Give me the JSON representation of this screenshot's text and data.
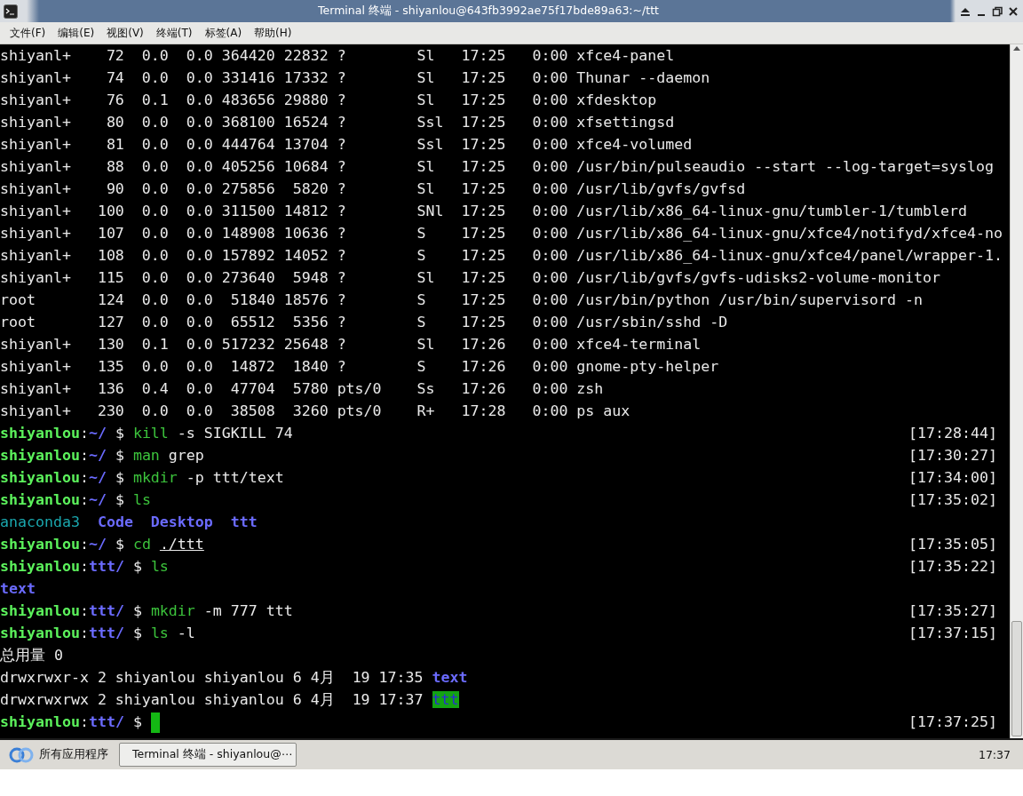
{
  "window": {
    "title": "Terminal 终端 - shiyanlou@643fb3992ae75f17bde89a63:~/ttt"
  },
  "menu": [
    {
      "label": "文件(F)"
    },
    {
      "label": "编辑(E)"
    },
    {
      "label": "视图(V)"
    },
    {
      "label": "终端(T)"
    },
    {
      "label": "标签(A)"
    },
    {
      "label": "帮助(H)"
    }
  ],
  "terminal": {
    "lines": [
      {
        "segments": [
          {
            "kind": "plain",
            "text": "shiyanl+    72  0.0  0.0 364420 22832 ?        Sl   17:25   0:00 xfce4-panel"
          }
        ]
      },
      {
        "segments": [
          {
            "kind": "plain",
            "text": "shiyanl+    74  0.0  0.0 331416 17332 ?        Sl   17:25   0:00 Thunar --daemon"
          }
        ]
      },
      {
        "segments": [
          {
            "kind": "plain",
            "text": "shiyanl+    76  0.1  0.0 483656 29880 ?        Sl   17:25   0:00 xfdesktop"
          }
        ]
      },
      {
        "segments": [
          {
            "kind": "plain",
            "text": "shiyanl+    80  0.0  0.0 368100 16524 ?        Ssl  17:25   0:00 xfsettingsd"
          }
        ]
      },
      {
        "segments": [
          {
            "kind": "plain",
            "text": "shiyanl+    81  0.0  0.0 444764 13704 ?        Ssl  17:25   0:00 xfce4-volumed"
          }
        ]
      },
      {
        "segments": [
          {
            "kind": "plain",
            "text": "shiyanl+    88  0.0  0.0 405256 10684 ?        Sl   17:25   0:00 /usr/bin/pulseaudio --start --log-target=syslog"
          }
        ]
      },
      {
        "segments": [
          {
            "kind": "plain",
            "text": "shiyanl+    90  0.0  0.0 275856  5820 ?        Sl   17:25   0:00 /usr/lib/gvfs/gvfsd"
          }
        ]
      },
      {
        "segments": [
          {
            "kind": "plain",
            "text": "shiyanl+   100  0.0  0.0 311500 14812 ?        SNl  17:25   0:00 /usr/lib/x86_64-linux-gnu/tumbler-1/tumblerd"
          }
        ]
      },
      {
        "segments": [
          {
            "kind": "plain",
            "text": "shiyanl+   107  0.0  0.0 148908 10636 ?        S    17:25   0:00 /usr/lib/x86_64-linux-gnu/xfce4/notifyd/xfce4-no"
          }
        ]
      },
      {
        "segments": [
          {
            "kind": "plain",
            "text": "shiyanl+   108  0.0  0.0 157892 14052 ?        S    17:25   0:00 /usr/lib/x86_64-linux-gnu/xfce4/panel/wrapper-1."
          }
        ]
      },
      {
        "segments": [
          {
            "kind": "plain",
            "text": "shiyanl+   115  0.0  0.0 273640  5948 ?        Sl   17:25   0:00 /usr/lib/gvfs/gvfs-udisks2-volume-monitor"
          }
        ]
      },
      {
        "segments": [
          {
            "kind": "plain",
            "text": "root       124  0.0  0.0  51840 18576 ?        S    17:25   0:00 /usr/bin/python /usr/bin/supervisord -n"
          }
        ]
      },
      {
        "segments": [
          {
            "kind": "plain",
            "text": "root       127  0.0  0.0  65512  5356 ?        S    17:25   0:00 /usr/sbin/sshd -D"
          }
        ]
      },
      {
        "segments": [
          {
            "kind": "plain",
            "text": "shiyanl+   130  0.1  0.0 517232 25648 ?        Sl   17:26   0:00 xfce4-terminal"
          }
        ]
      },
      {
        "segments": [
          {
            "kind": "plain",
            "text": "shiyanl+   135  0.0  0.0  14872  1840 ?        S    17:26   0:00 gnome-pty-helper"
          }
        ]
      },
      {
        "segments": [
          {
            "kind": "plain",
            "text": "shiyanl+   136  0.4  0.0  47704  5780 pts/0    Ss   17:26   0:00 zsh"
          }
        ]
      },
      {
        "segments": [
          {
            "kind": "plain",
            "text": "shiyanl+   230  0.0  0.0  38508  3260 pts/0    R+   17:28   0:00 ps aux"
          }
        ]
      },
      {
        "segments": [
          {
            "kind": "user",
            "text": "shiyanlou"
          },
          {
            "kind": "plain",
            "text": ":"
          },
          {
            "kind": "path",
            "text": "~/"
          },
          {
            "kind": "plain",
            "text": " $ "
          },
          {
            "kind": "cmd",
            "text": "kill"
          },
          {
            "kind": "plain",
            "text": " -s SIGKILL 74"
          }
        ],
        "time": "[17:28:44]"
      },
      {
        "segments": [
          {
            "kind": "user",
            "text": "shiyanlou"
          },
          {
            "kind": "plain",
            "text": ":"
          },
          {
            "kind": "path",
            "text": "~/"
          },
          {
            "kind": "plain",
            "text": " $ "
          },
          {
            "kind": "cmd",
            "text": "man"
          },
          {
            "kind": "plain",
            "text": " grep"
          }
        ],
        "time": "[17:30:27]"
      },
      {
        "segments": [
          {
            "kind": "user",
            "text": "shiyanlou"
          },
          {
            "kind": "plain",
            "text": ":"
          },
          {
            "kind": "path",
            "text": "~/"
          },
          {
            "kind": "plain",
            "text": " $ "
          },
          {
            "kind": "cmd",
            "text": "mkdir"
          },
          {
            "kind": "plain",
            "text": " -p ttt/text"
          }
        ],
        "time": "[17:34:00]"
      },
      {
        "segments": [
          {
            "kind": "user",
            "text": "shiyanlou"
          },
          {
            "kind": "plain",
            "text": ":"
          },
          {
            "kind": "path",
            "text": "~/"
          },
          {
            "kind": "plain",
            "text": " $ "
          },
          {
            "kind": "cmd",
            "text": "ls"
          }
        ],
        "time": "[17:35:02]"
      },
      {
        "segments": [
          {
            "kind": "link",
            "text": "anaconda3  "
          },
          {
            "kind": "dir",
            "text": "Code  "
          },
          {
            "kind": "dir",
            "text": "Desktop  "
          },
          {
            "kind": "dir",
            "text": "ttt"
          }
        ]
      },
      {
        "segments": [
          {
            "kind": "user",
            "text": "shiyanlou"
          },
          {
            "kind": "plain",
            "text": ":"
          },
          {
            "kind": "path",
            "text": "~/"
          },
          {
            "kind": "plain",
            "text": " $ "
          },
          {
            "kind": "cmd",
            "text": "cd "
          },
          {
            "kind": "underline",
            "text": "./ttt"
          }
        ],
        "time": "[17:35:05]"
      },
      {
        "segments": [
          {
            "kind": "user",
            "text": "shiyanlou"
          },
          {
            "kind": "plain",
            "text": ":"
          },
          {
            "kind": "path",
            "text": "ttt/"
          },
          {
            "kind": "plain",
            "text": " $ "
          },
          {
            "kind": "cmd",
            "text": "ls"
          }
        ],
        "time": "[17:35:22]"
      },
      {
        "segments": [
          {
            "kind": "dir",
            "text": "text"
          }
        ]
      },
      {
        "segments": [
          {
            "kind": "user",
            "text": "shiyanlou"
          },
          {
            "kind": "plain",
            "text": ":"
          },
          {
            "kind": "path",
            "text": "ttt/"
          },
          {
            "kind": "plain",
            "text": " $ "
          },
          {
            "kind": "cmd",
            "text": "mkdir"
          },
          {
            "kind": "plain",
            "text": " -m 777 ttt"
          }
        ],
        "time": "[17:35:27]"
      },
      {
        "segments": [
          {
            "kind": "user",
            "text": "shiyanlou"
          },
          {
            "kind": "plain",
            "text": ":"
          },
          {
            "kind": "path",
            "text": "ttt/"
          },
          {
            "kind": "plain",
            "text": " $ "
          },
          {
            "kind": "cmd",
            "text": "ls"
          },
          {
            "kind": "plain",
            "text": " -l"
          }
        ],
        "time": "[17:37:15]"
      },
      {
        "segments": [
          {
            "kind": "plain",
            "text": "总用量 0"
          }
        ]
      },
      {
        "segments": [
          {
            "kind": "plain",
            "text": "drwxrwxr-x 2 shiyanlou shiyanlou 6 4月  19 17:35 "
          },
          {
            "kind": "dir",
            "text": "text"
          }
        ]
      },
      {
        "segments": [
          {
            "kind": "plain",
            "text": "drwxrwxrwx 2 shiyanlou shiyanlou 6 4月  19 17:37 "
          },
          {
            "kind": "highlight",
            "text": "ttt"
          }
        ]
      },
      {
        "segments": [
          {
            "kind": "user",
            "text": "shiyanlou"
          },
          {
            "kind": "plain",
            "text": ":"
          },
          {
            "kind": "path",
            "text": "ttt/"
          },
          {
            "kind": "plain",
            "text": " $ "
          },
          {
            "kind": "cursor"
          }
        ],
        "time": "[17:37:25]"
      }
    ]
  },
  "taskbar": {
    "start_label": "所有应用程序",
    "tasks": [
      {
        "label": "Terminal 终端 - shiyanlou@⋯",
        "selected": true
      }
    ],
    "clock": "17:37"
  }
}
